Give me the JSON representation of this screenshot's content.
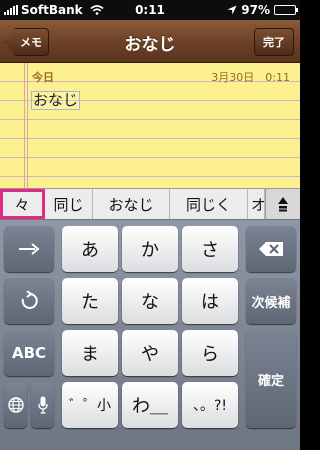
{
  "status_bar": {
    "carrier": "SoftBank",
    "time": "0:11",
    "battery": "97%",
    "battery_level": 0.97
  },
  "nav": {
    "back_label": "メモ",
    "title": "おなじ",
    "done_label": "完了"
  },
  "note": {
    "date_label": "今日",
    "datetime": "3月30日　0:11",
    "text": "おなじ"
  },
  "candidates": [
    {
      "label": "々",
      "selected": true
    },
    {
      "label": "同じ",
      "selected": false
    },
    {
      "label": "おなじ",
      "selected": false
    },
    {
      "label": "同じく",
      "selected": false
    },
    {
      "label": "オ",
      "selected": false
    }
  ],
  "keyboard": {
    "row1": [
      "あ",
      "か",
      "さ"
    ],
    "row2": [
      "た",
      "な",
      "は"
    ],
    "row3": [
      "ま",
      "や",
      "ら"
    ],
    "row4": [
      "゛゜小",
      "わ＿",
      "、。?!"
    ],
    "next_candidate": "次候補",
    "abc": "ABC",
    "confirm": "確定",
    "icons": {
      "arrow": "right-arrow-icon",
      "undo": "undo-icon",
      "globe": "globe-icon",
      "mic": "microphone-icon",
      "delete": "backspace-icon",
      "expand": "expand-candidates-icon"
    }
  }
}
